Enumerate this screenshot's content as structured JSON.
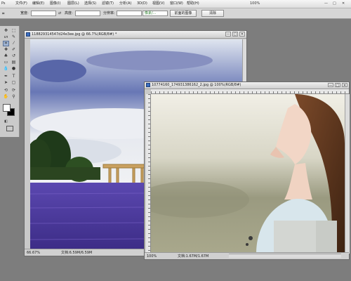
{
  "app": {
    "logo": "Ps"
  },
  "menu": [
    {
      "label": "文件(F)"
    },
    {
      "label": "编辑(E)"
    },
    {
      "label": "图像(I)"
    },
    {
      "label": "图层(L)"
    },
    {
      "label": "选择(S)"
    },
    {
      "label": "滤镜(T)"
    },
    {
      "label": "分析(A)"
    },
    {
      "label": "3D(D)"
    },
    {
      "label": "视图(V)"
    },
    {
      "label": "窗口(W)"
    },
    {
      "label": "帮助(H)"
    }
  ],
  "title_controls": {
    "zoom": "100%",
    "minimize": "—",
    "maximize": "□",
    "close": "✕"
  },
  "options": {
    "width_label": "宽度:",
    "height_label": "高度:",
    "resolution_label": "分辨率:",
    "unit_value": "像素/...",
    "front_image_button": "前面的图像",
    "clear_button": "清除"
  },
  "doc1": {
    "title": "118829314547d24e3ee.jpg @ 66.7%(RGB/8#) *",
    "zoom": "66.67%",
    "info": "文档:6.59M/6.59M"
  },
  "doc2": {
    "title": "10774160_174931386162_2.jpg @ 100%(RGB/8#)",
    "zoom": "100%",
    "info": "文档:1.67M/1.67M"
  },
  "colors": {
    "foreground": "#ffffff",
    "background": "#000000",
    "lavender": "#5b48b0",
    "sky": "#6877b5"
  },
  "tools": [
    {
      "icon": "move-tool-icon"
    },
    {
      "icon": "marquee-tool-icon"
    },
    {
      "icon": "lasso-tool-icon"
    },
    {
      "icon": "crop-tool-icon"
    },
    {
      "icon": "eyedropper-tool-icon"
    },
    {
      "icon": "healing-brush-icon"
    },
    {
      "icon": "brush-tool-icon"
    },
    {
      "icon": "clone-stamp-icon"
    },
    {
      "icon": "history-brush-icon"
    },
    {
      "icon": "eraser-tool-icon"
    },
    {
      "icon": "gradient-tool-icon"
    },
    {
      "icon": "blur-tool-icon"
    },
    {
      "icon": "dodge-tool-icon"
    },
    {
      "icon": "pen-tool-icon"
    },
    {
      "icon": "type-tool-icon"
    },
    {
      "icon": "path-selection-icon"
    },
    {
      "icon": "shape-tool-icon"
    },
    {
      "icon": "3d-rotate-icon"
    },
    {
      "icon": "3d-camera-icon"
    },
    {
      "icon": "hand-tool-icon"
    },
    {
      "icon": "zoom-tool-icon"
    }
  ]
}
